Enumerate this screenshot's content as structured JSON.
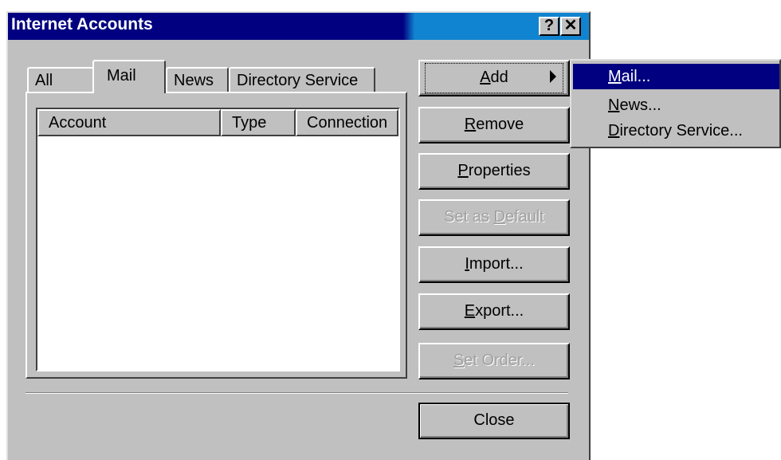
{
  "window": {
    "title": "Internet Accounts",
    "help_button": "?",
    "close_button": "✕"
  },
  "tabs": [
    {
      "label": "All"
    },
    {
      "label": "Mail"
    },
    {
      "label": "News"
    },
    {
      "label": "Directory Service"
    }
  ],
  "list": {
    "columns": [
      "Account",
      "Type",
      "Connection"
    ],
    "rows": []
  },
  "buttons": {
    "add": {
      "pre": "",
      "u": "A",
      "post": "dd"
    },
    "remove": {
      "pre": "",
      "u": "R",
      "post": "emove"
    },
    "properties": {
      "pre": "",
      "u": "P",
      "post": "roperties"
    },
    "set_default": {
      "pre": "Set as ",
      "u": "D",
      "post": "efault"
    },
    "import": {
      "pre": "",
      "u": "I",
      "post": "mport..."
    },
    "export": {
      "pre": "",
      "u": "E",
      "post": "xport..."
    },
    "set_order": {
      "pre": "",
      "u": "S",
      "post": "et Order..."
    },
    "close": "Close"
  },
  "add_menu": [
    {
      "u": "M",
      "rest": "ail...",
      "selected": true
    },
    {
      "u": "N",
      "rest": "ews...",
      "selected": false
    },
    {
      "u": "D",
      "rest": "irectory Service...",
      "selected": false
    }
  ],
  "colors": {
    "titlebar": "#000080",
    "face": "#c0c0c0",
    "highlight": "#000080"
  }
}
